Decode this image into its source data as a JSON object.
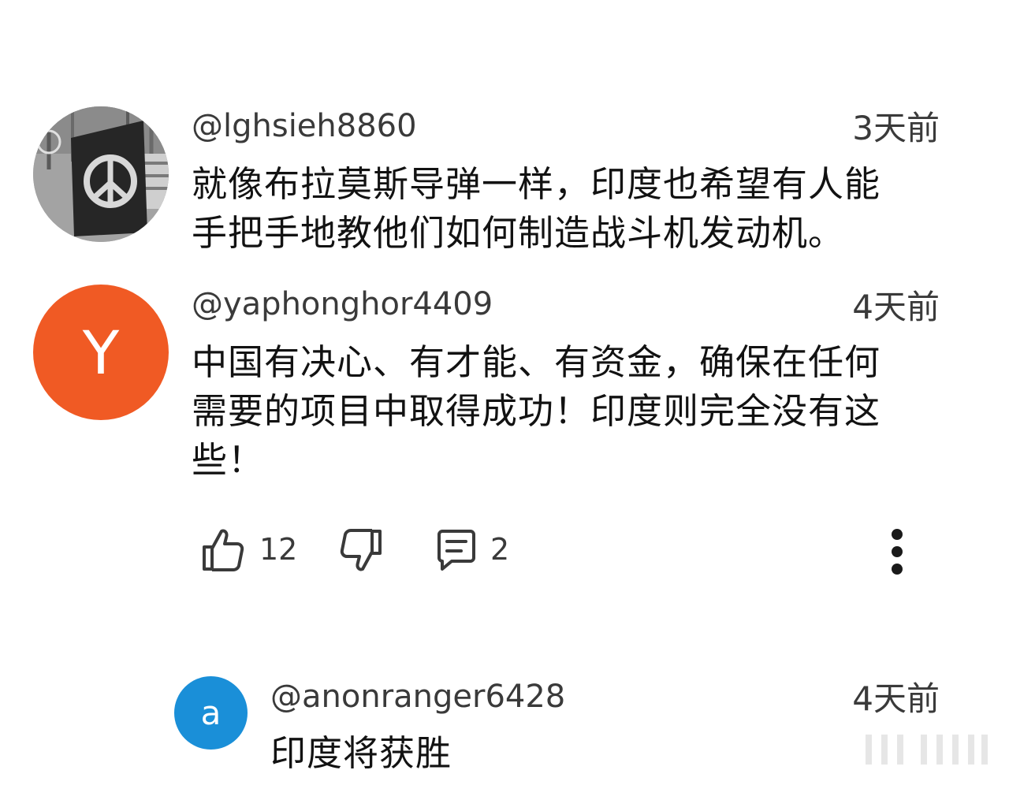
{
  "comments": [
    {
      "avatar_icon": "peace-flag-photo",
      "handle": "@lghsieh8860",
      "time": "3天前",
      "lines": [
        "就像布拉莫斯导弹一样，印度也希望有人能",
        "手把手地教他们如何制造战斗机发动机。"
      ]
    },
    {
      "avatar_letter": "Y",
      "avatar_color": "#f05a24",
      "handle": "@yaphonghor4409",
      "time": "4天前",
      "lines": [
        "中国有决心、有才能、有资金，确保在任何",
        "需要的项目中取得成功！印度则完全没有这",
        "些！"
      ],
      "likes": "12",
      "replies": "2"
    }
  ],
  "reply": {
    "avatar_letter": "a",
    "avatar_color": "#1a8fd8",
    "handle": "@anonranger6428",
    "time": "4天前",
    "text": "印度将获胜"
  },
  "icons": {
    "like": "thumbs-up-icon",
    "dislike": "thumbs-down-icon",
    "reply": "comment-icon",
    "more": "more-vertical-icon"
  }
}
